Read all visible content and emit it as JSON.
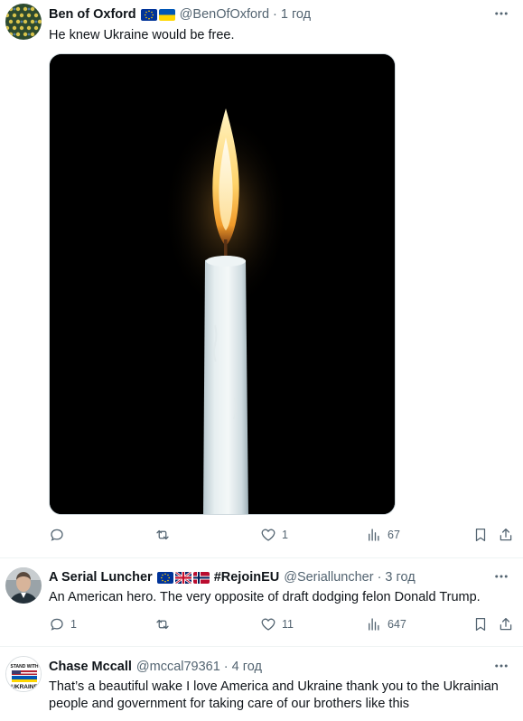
{
  "tweets": [
    {
      "display_name": "Ben of Oxford",
      "flags": [
        "eu-flag",
        "ukraine-flag"
      ],
      "handle": "@BenOfOxford",
      "separator": "·",
      "time": "1 год",
      "text": "He knew Ukraine would be free.",
      "media": "candle-image",
      "replies": "",
      "reposts": "",
      "likes": "1",
      "views": "67"
    },
    {
      "display_name": "A Serial Luncher",
      "flags": [
        "eu-flag",
        "uk-flag",
        "norway-flag"
      ],
      "hashtag": "#RejoinEU",
      "handle": "@Serialluncher",
      "separator": "·",
      "time": "3 год",
      "text": "An American hero. The very opposite of draft dodging felon Donald Trump.",
      "replies": "1",
      "reposts": "",
      "likes": "11",
      "views": "647"
    },
    {
      "display_name": "Chase Mccall",
      "handle": "@mccal79361",
      "separator": "·",
      "time": "4 год",
      "text": "That’s a beautiful wake I love America and Ukraine thank you to the Ukrainian people and government for taking care of our brothers like this",
      "avatar_text_top": "STAND WITH",
      "avatar_text_bottom": "UKRAINE"
    }
  ],
  "icons": {
    "reply": "reply-icon",
    "repost": "repost-icon",
    "like": "heart-icon",
    "views": "views-icon",
    "bookmark": "bookmark-icon",
    "share": "share-icon",
    "more": "more-icon"
  },
  "colors": {
    "secondary_text": "#536471",
    "divider": "#eff3f4",
    "eu_blue": "#003399",
    "eu_gold": "#ffcc00",
    "ua_blue": "#0057b7",
    "ua_yellow": "#ffd700"
  }
}
